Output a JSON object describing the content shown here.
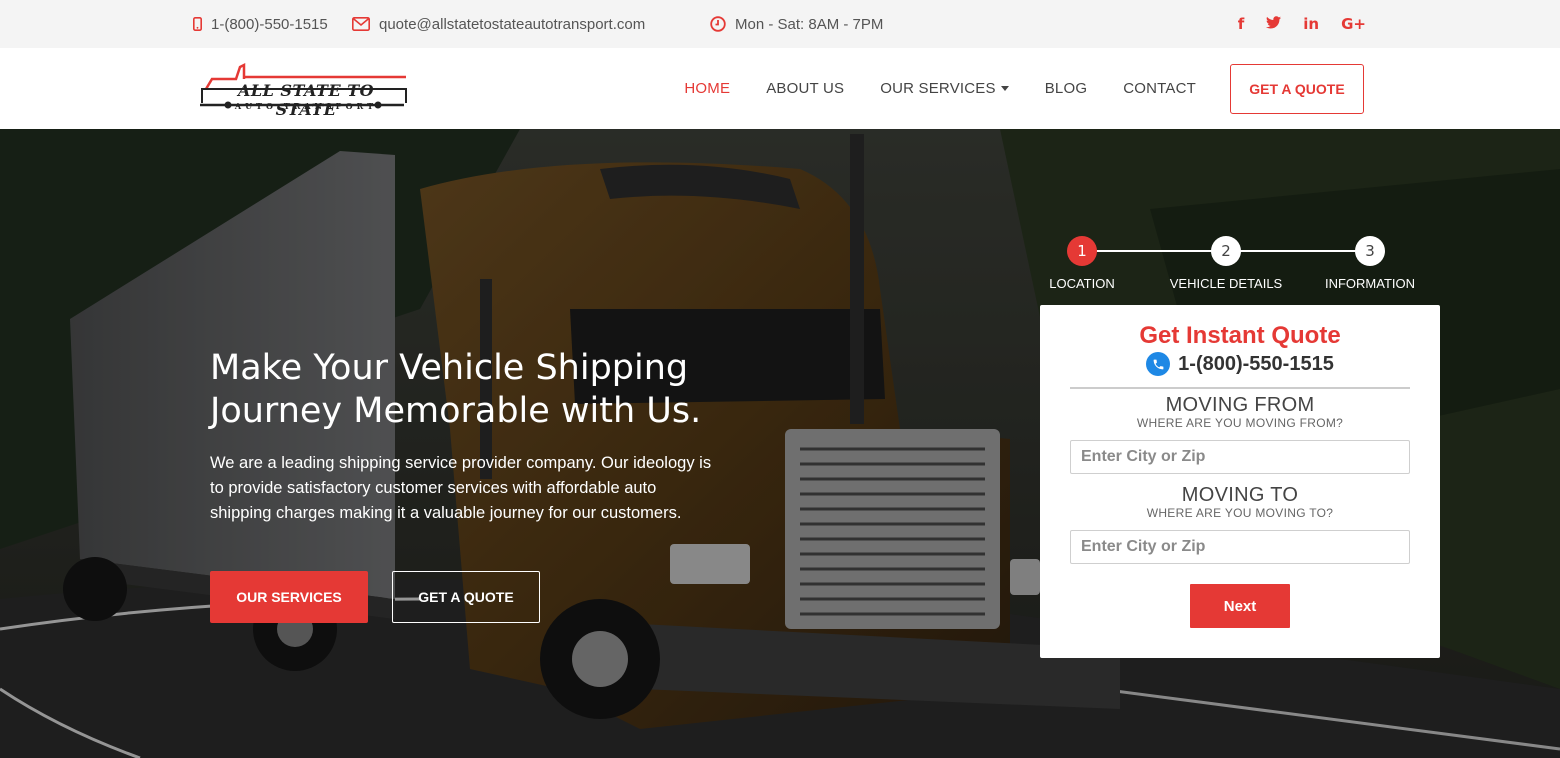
{
  "topbar": {
    "phone": "1-(800)-550-1515",
    "email": "quote@allstatetostateautotransport.com",
    "hours": "Mon - Sat: 8AM - 7PM",
    "socials": [
      {
        "icon": "facebook-icon",
        "glyph": "f"
      },
      {
        "icon": "twitter-icon",
        "glyph": "t"
      },
      {
        "icon": "linkedin-icon",
        "glyph": "in"
      },
      {
        "icon": "google-plus-icon",
        "glyph": "G+"
      }
    ]
  },
  "logo": {
    "line1": "ALL STATE TO STATE",
    "line2": "AUTO TRANSPORT"
  },
  "nav": {
    "items": [
      "HOME",
      "ABOUT US",
      "OUR SERVICES",
      "BLOG",
      "CONTACT"
    ],
    "cta": "GET A QUOTE"
  },
  "hero": {
    "title_line1": "Make Your Vehicle Shipping",
    "title_line2": "Journey Memorable with Us.",
    "text": "We are a leading shipping service provider company. Our ideology is to provide satisfactory customer services with affordable auto shipping charges making it a valuable journey for our customers.",
    "btn_services": "OUR SERVICES",
    "btn_quote": "GET A QUOTE"
  },
  "steps": [
    {
      "num": "1",
      "label": "LOCATION"
    },
    {
      "num": "2",
      "label": "VEHICLE DETAILS"
    },
    {
      "num": "3",
      "label": "INFORMATION"
    }
  ],
  "quote": {
    "title": "Get Instant Quote",
    "phone": "1-(800)-550-1515",
    "from_head": "MOVING FROM",
    "from_sub": "WHERE ARE YOU MOVING FROM?",
    "from_placeholder": "Enter City or Zip",
    "to_head": "MOVING TO",
    "to_sub": "WHERE ARE YOU MOVING TO?",
    "to_placeholder": "Enter City or Zip",
    "next": "Next"
  },
  "colors": {
    "accent": "#e53935",
    "phone_badge": "#1e88e5"
  }
}
